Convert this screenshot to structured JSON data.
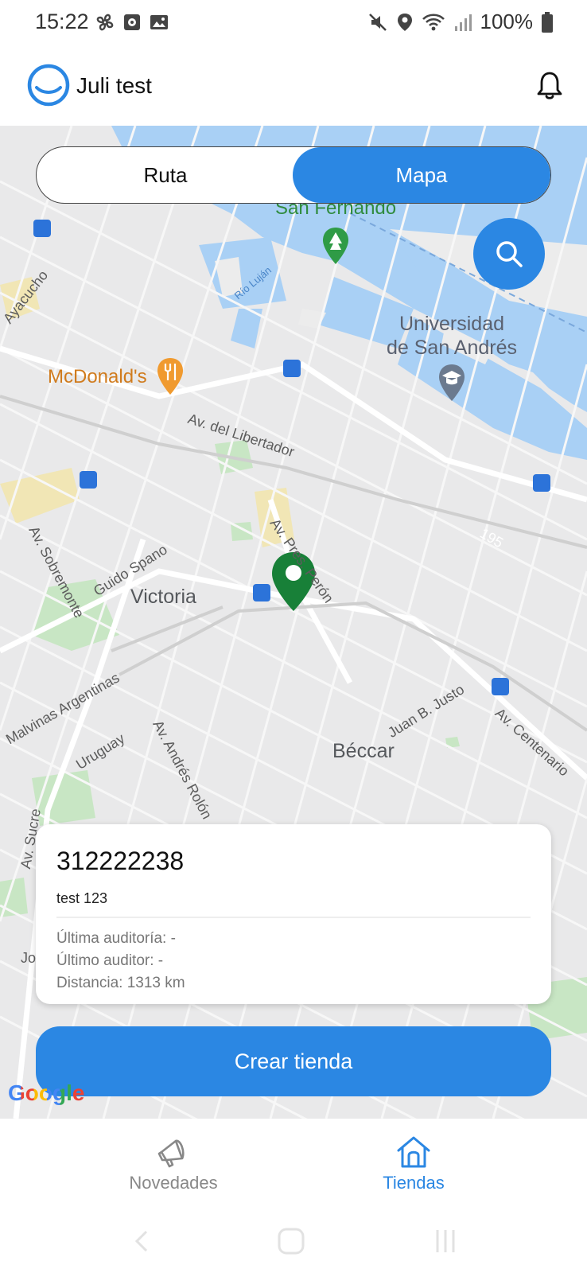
{
  "status_bar": {
    "time": "15:22",
    "battery": "100%",
    "left_icons": [
      "pinwheel-icon",
      "clock-app-icon",
      "gallery-icon"
    ],
    "right_icons": [
      "mute-icon",
      "location-icon",
      "wifi-icon",
      "signal-icon",
      "battery-icon"
    ]
  },
  "header": {
    "user_name": "Juli test",
    "logo_icon": "app-logo-icon",
    "notification_icon": "bell-icon"
  },
  "toggle": {
    "route_label": "Ruta",
    "map_label": "Mapa",
    "selected": "Mapa"
  },
  "map": {
    "labels": {
      "san_fernando": "San Fernando",
      "rio_lujan": "Río Luján",
      "ayacucho": "Ayacucho",
      "universidad": "Universidad\nde San Andrés",
      "mcdonalds": "McDonald's",
      "libertador": "Av. del Libertador",
      "sobremonte": "Av. Sobremonte",
      "guido_spano": "Guido Spano",
      "pres_peron": "Av. Pres. Perón",
      "victoria": "Victoria",
      "malvinas": "Malvinas Argentinas",
      "uruguay": "Uruguay",
      "andres_rolon": "Av. Andrés Rolón",
      "juan_b_justo": "Juan B. Justo",
      "beccar": "Béccar",
      "centenario": "Av. Centenario",
      "sucre": "Av. Sucre",
      "route_195": "195",
      "partial_jo": "Jo"
    },
    "attribution": "Google"
  },
  "store_card": {
    "code": "312222238",
    "name": "test 123",
    "last_audit": "Última auditoría: -",
    "last_auditor": "Último auditor: -",
    "distance": "Distancia: 1313 km"
  },
  "actions": {
    "create_store": "Crear tienda"
  },
  "bottom_nav": {
    "items": [
      {
        "label": "Novedades",
        "icon": "megaphone-icon",
        "active": false
      },
      {
        "label": "Tiendas",
        "icon": "store-home-icon",
        "active": true
      }
    ]
  },
  "colors": {
    "accent": "#2b87e3",
    "marker": "#188038",
    "water": "#a9d0f5",
    "map_bg": "#e9e9ea"
  }
}
